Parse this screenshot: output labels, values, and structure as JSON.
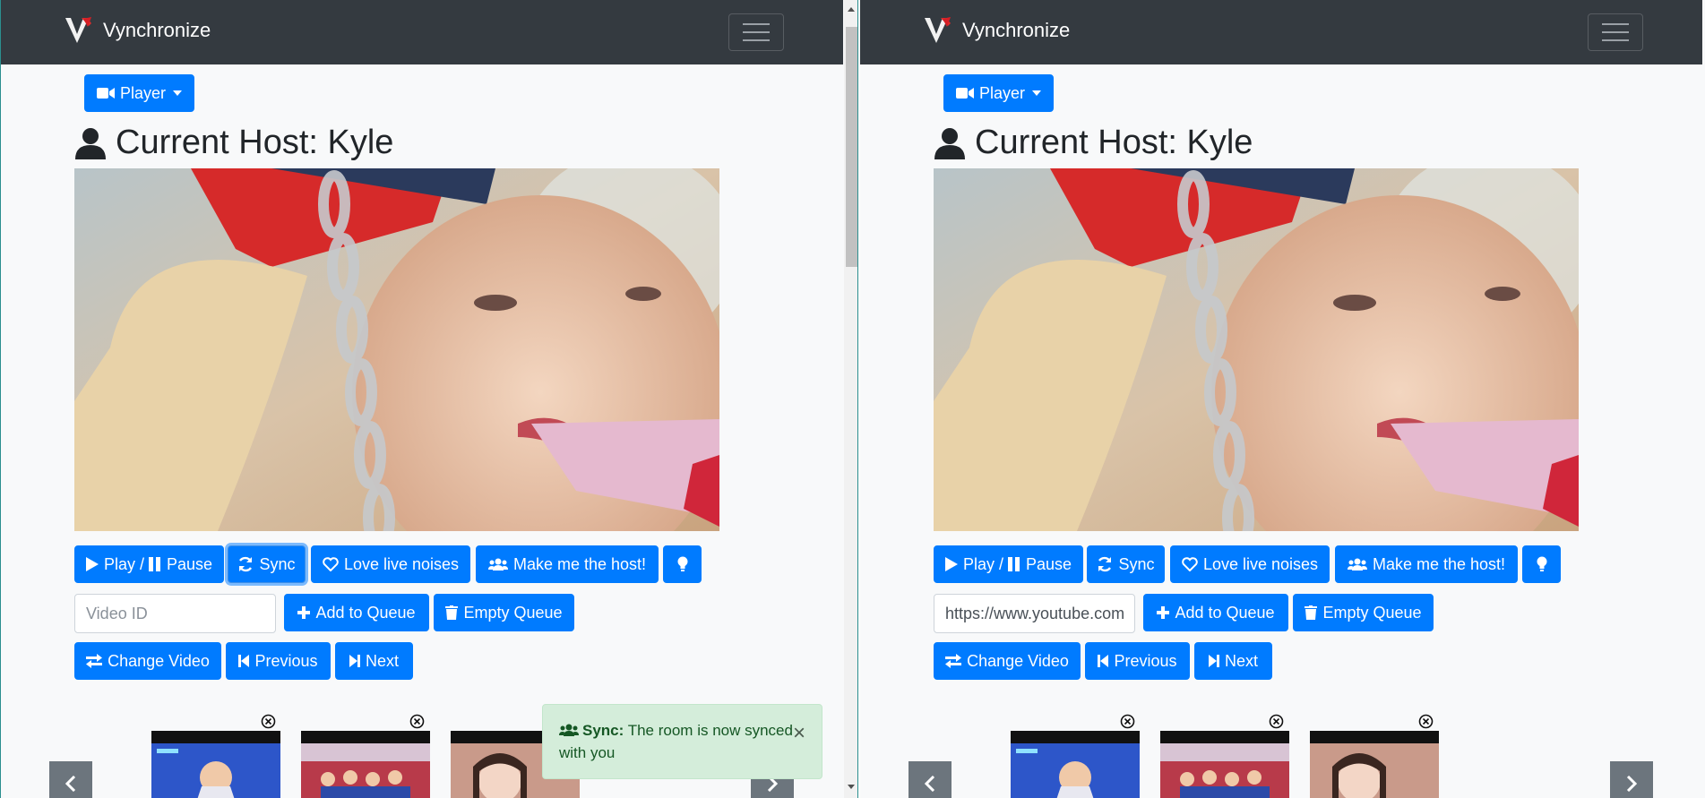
{
  "app": {
    "name": "Vynchronize"
  },
  "colors": {
    "primary": "#007bff",
    "navbar": "#343a40",
    "success_bg": "#d4edda",
    "success_text": "#155724",
    "carousel_button": "#6c757d"
  },
  "icons": {
    "logo": "vynchronize-v-logo",
    "menu": "hamburger-icon",
    "player": "video-camera-icon",
    "host": "user-icon",
    "play_pause": "play-pause-icon",
    "sync": "sync-icon",
    "love": "heart-icon",
    "make_host": "users-icon",
    "hint": "lightbulb-icon",
    "add": "plus-icon",
    "empty": "trash-icon",
    "change": "exchange-icon",
    "previous": "step-backward-icon",
    "next": "step-forward-icon",
    "remove": "circle-x-icon",
    "toast": "users-icon"
  },
  "left": {
    "player_dropdown": "Player",
    "host_title": "Current Host: Kyle",
    "buttons": {
      "play_pause": "Play / ",
      "pause": "Pause",
      "sync": "Sync",
      "love": "Love live noises",
      "make_host": "Make me the host!",
      "add_queue": "Add to Queue",
      "empty_queue": "Empty Queue",
      "change_video": "Change Video",
      "previous": "Previous",
      "next": "Next"
    },
    "video_input": {
      "placeholder": "Video ID",
      "value": ""
    },
    "toast": {
      "title": "Sync:",
      "message": "The room is now synced with you"
    }
  },
  "right": {
    "player_dropdown": "Player",
    "host_title": "Current Host: Kyle",
    "buttons": {
      "play_pause": "Play / ",
      "pause": "Pause",
      "sync": "Sync",
      "love": "Love live noises",
      "make_host": "Make me the host!",
      "add_queue": "Add to Queue",
      "empty_queue": "Empty Queue",
      "change_video": "Change Video",
      "previous": "Previous",
      "next": "Next"
    },
    "video_input": {
      "placeholder": "Video ID",
      "value": "https://www.youtube.com"
    }
  }
}
